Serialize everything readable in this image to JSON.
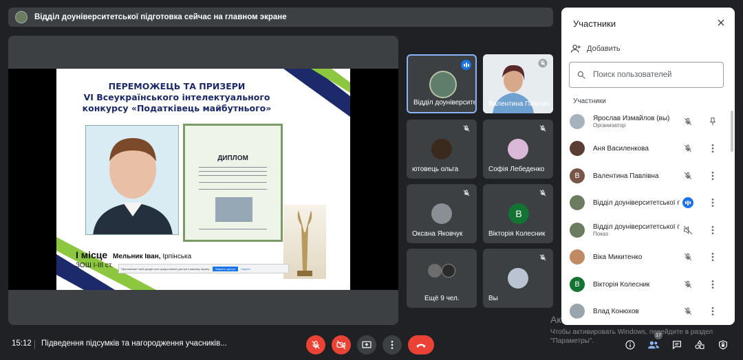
{
  "banner": {
    "text": "Відділ доуніверситетської підготовка сейчас на главном экране"
  },
  "slide": {
    "title_line1": "ПЕРЕМОЖЕЦЬ ТА ПРИЗЕРИ",
    "title_line2": "VI Всеукраїнського інтелектуального",
    "title_line3": "конкурсу «Податківець майбутнього»",
    "diploma_title": "ДИПЛОМ",
    "place": "І місце",
    "winner_name": "Мельник Іван,",
    "winner_school_a": "Ірпінська",
    "winner_school_b": "ЗОШ І-ІІІ ст.",
    "share_text": "Приложение meet.google.com предоставило доступ к вашему экрану.",
    "share_stop": "Закрыть доступ",
    "share_hide": "Скрыть"
  },
  "tiles": [
    {
      "name": "Відділ доуніверситетської підготовки"
    },
    {
      "name": "Валентина Павлівна"
    },
    {
      "name": "ютовець ольга"
    },
    {
      "name": "Софія Лебеденко"
    },
    {
      "name": "Оксана Яковчук"
    },
    {
      "name": "Вікторія Колесник",
      "letter": "В"
    },
    {
      "name": "Ещё 9 чел."
    },
    {
      "name": "Вы"
    }
  ],
  "panel": {
    "title": "Участники",
    "add_label": "Добавить",
    "search_placeholder": "Поиск пользователей",
    "section": "Участники",
    "participants": [
      {
        "name": "Ярослав Измайлов (вы)",
        "sub": "Организатор"
      },
      {
        "name": "Аня Василенкова",
        "sub": ""
      },
      {
        "name": "Валентина Павлівна",
        "sub": "",
        "letter": "В"
      },
      {
        "name": "Відділ доуніверситетської підготовки",
        "sub": ""
      },
      {
        "name": "Відділ доуніверситетської підготовки",
        "sub": "Показ"
      },
      {
        "name": "Віка Микитенко",
        "sub": ""
      },
      {
        "name": "Вікторія Колесник",
        "sub": "",
        "letter": "В"
      },
      {
        "name": "Влад Конюхов",
        "sub": ""
      }
    ]
  },
  "watermark": {
    "title": "Активация Windows",
    "text": "Чтобы активировать Windows, перейдите в раздел \"Параметры\"."
  },
  "bottom": {
    "time": "15:12",
    "meeting_title": "Підведення підсумків та нагородження учасників...",
    "participants_count": "17"
  },
  "colors": {
    "end_call": "#ea4335",
    "accent": "#1a73e8",
    "panel_bg": "#ffffff",
    "dark_bg": "#202124"
  }
}
